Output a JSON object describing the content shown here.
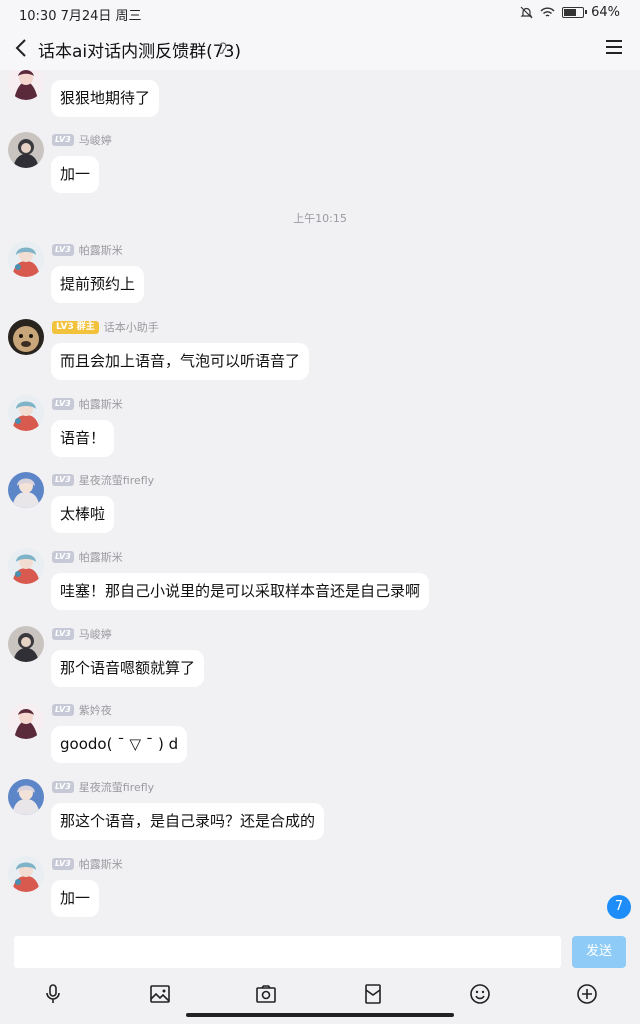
{
  "status": {
    "time": "10:30 7月24日 周三",
    "battery": "64%",
    "battery_level": 0.64
  },
  "header": {
    "title": "话本ai对话内测反馈群(73)"
  },
  "messages": [
    {
      "sender": "",
      "level": "",
      "text": "狠狠地期待了"
    },
    {
      "sender": "马峻婷",
      "level": "LV3",
      "text": "加一"
    },
    {
      "time": "上午10:15"
    },
    {
      "sender": "帕露斯米",
      "level": "LV3",
      "text": "提前预约上"
    },
    {
      "sender": "话本小助手",
      "level": "LV3",
      "role": "群主",
      "text": "而且会加上语音，气泡可以听语音了"
    },
    {
      "sender": "帕露斯米",
      "level": "LV3",
      "text": "语音！"
    },
    {
      "sender": "星夜流萤firefly",
      "level": "LV3",
      "text": "太棒啦"
    },
    {
      "sender": "帕露斯米",
      "level": "LV3",
      "text": "哇塞！那自己小说里的是可以采取样本音还是自己录啊"
    },
    {
      "sender": "马峻婷",
      "level": "LV3",
      "text": "那个语音嗯额就算了"
    },
    {
      "sender": "紫妗夜",
      "level": "LV3",
      "text": "goodo( ˉ ▽ ˉ ) d"
    },
    {
      "sender": "星夜流萤firefly",
      "level": "LV3",
      "text": "那这个语音，是自己录吗？还是合成的"
    },
    {
      "sender": "帕露斯米",
      "level": "LV3",
      "text": "加一"
    }
  ],
  "unread": "7",
  "composer": {
    "placeholder": "",
    "send_label": "发送"
  },
  "icons": {
    "back": "back-arrow-icon",
    "ear": "ear-icon",
    "menu": "menu-icon",
    "toolbar": [
      "microphone-icon",
      "image-icon",
      "camera-icon",
      "red-packet-icon",
      "emoji-icon",
      "plus-icon"
    ]
  },
  "colors": {
    "accent": "#1f8df7",
    "send_disabled": "#8ecbf7",
    "owner_badge": "#f3c23c",
    "level_badge": "#c7cad6"
  }
}
